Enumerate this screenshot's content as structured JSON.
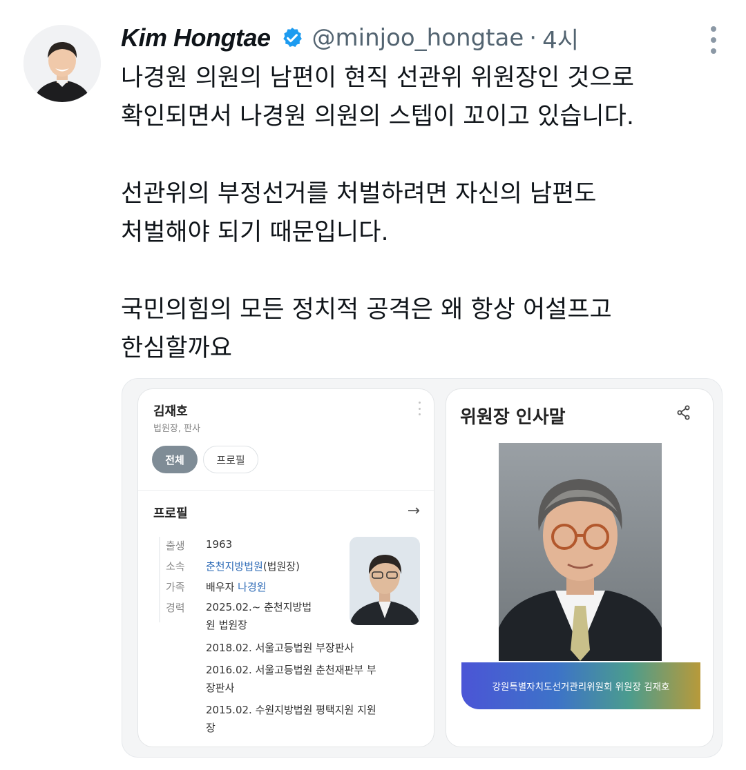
{
  "tweet": {
    "author_name": "Kim Hongtae",
    "handle": "@minjoo_hongtae",
    "separator": "·",
    "time": "4시",
    "lines": [
      "나경원 의원의 남편이 현직 선관위 위원장인 것으로",
      "확인되면서 나경원 의원의 스텝이 꼬이고 있습니다.",
      "",
      "선관위의 부정선거를 처벌하려면 자신의 남편도",
      "처벌해야 되기 때문입니다.",
      "",
      "국민의힘의 모든 정치적 공격은 왜 항상 어설프고",
      "한심할까요"
    ],
    "icons": {
      "verified": "verified-badge-icon",
      "more": "more-options-icon"
    },
    "colors": {
      "verified": "#1d9bf0",
      "muted": "#536471"
    }
  },
  "left_card": {
    "person_name": "김재호",
    "person_role": "법원장, 판사",
    "tabs": [
      "전체",
      "프로필"
    ],
    "section_title": "프로필",
    "arrow": "→",
    "rows": [
      {
        "label": "출생",
        "value": "1963"
      },
      {
        "label": "소속",
        "link": "춘천지방법원",
        "rest": "(법원장)"
      },
      {
        "label": "가족",
        "prefix": "배우자 ",
        "link": "나경원"
      },
      {
        "label": "경력"
      }
    ],
    "career": [
      "2025.02.~ 춘천지방법",
      "원 법원장",
      "2018.02. 서울고등법원 부장판사",
      "2016.02. 서울고등법원 춘천재판부 부",
      "장판사",
      "2015.02. 수원지방법원 평택지원 지원",
      "장"
    ]
  },
  "right_card": {
    "title": "위원장 인사말",
    "caption": "강원특별자치도선거관리위원회 위원장 김재호",
    "icons": {
      "share": "share-icon"
    }
  }
}
